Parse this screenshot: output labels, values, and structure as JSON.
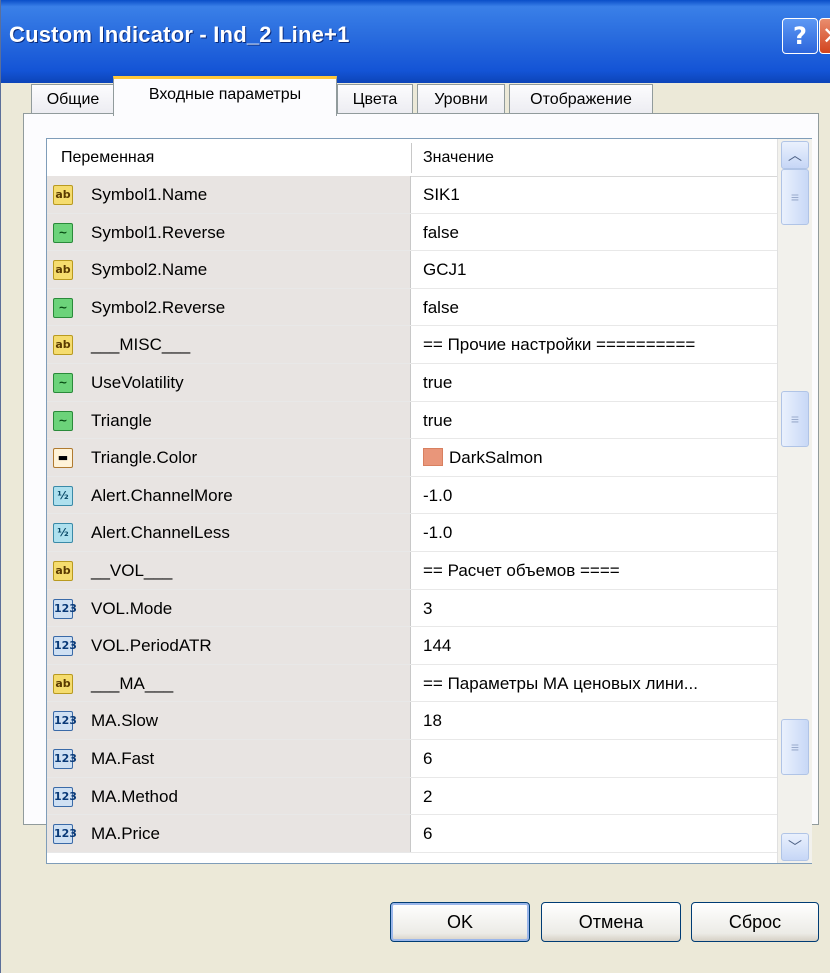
{
  "window": {
    "title": "Custom Indicator - Ind_2 Line+1",
    "help_glyph": "?",
    "close_glyph": "✕"
  },
  "tabs": [
    {
      "label": "Общие"
    },
    {
      "label": "Входные параметры",
      "active": true
    },
    {
      "label": "Цвета"
    },
    {
      "label": "Уровни"
    },
    {
      "label": "Отображение"
    }
  ],
  "grid": {
    "headers": {
      "variable": "Переменная",
      "value": "Значение"
    },
    "rows": [
      {
        "type": "string",
        "name": "Symbol1.Name",
        "value": "SIK1"
      },
      {
        "type": "bool",
        "name": "Symbol1.Reverse",
        "value": "false"
      },
      {
        "type": "string",
        "name": "Symbol2.Name",
        "value": "GCJ1"
      },
      {
        "type": "bool",
        "name": "Symbol2.Reverse",
        "value": "false"
      },
      {
        "type": "string",
        "name": "___MISC___",
        "value": "== Прочие настройки =========="
      },
      {
        "type": "bool",
        "name": "UseVolatility",
        "value": "true"
      },
      {
        "type": "bool",
        "name": "Triangle",
        "value": "true"
      },
      {
        "type": "color",
        "name": "Triangle.Color",
        "value": "DarkSalmon",
        "swatch": "#e9967a"
      },
      {
        "type": "double",
        "name": "Alert.ChannelMore",
        "value": "-1.0"
      },
      {
        "type": "double",
        "name": "Alert.ChannelLess",
        "value": "-1.0"
      },
      {
        "type": "string",
        "name": "__VOL___",
        "value": "== Расчет объемов ===="
      },
      {
        "type": "int",
        "name": "VOL.Mode",
        "value": "3"
      },
      {
        "type": "int",
        "name": "VOL.PeriodATR",
        "value": "144"
      },
      {
        "type": "string",
        "name": "___MA___",
        "value": "== Параметры МА ценовых лини..."
      },
      {
        "type": "int",
        "name": "MA.Slow",
        "value": "18"
      },
      {
        "type": "int",
        "name": "MA.Fast",
        "value": "6"
      },
      {
        "type": "int",
        "name": "MA.Method",
        "value": "2"
      },
      {
        "type": "int",
        "name": "MA.Price",
        "value": "6"
      }
    ]
  },
  "icon_glyphs": {
    "string": "ab",
    "bool": "∼",
    "color": "▬",
    "double": "½",
    "int": "123"
  },
  "buttons": {
    "ok": "OK",
    "cancel": "Отмена",
    "reset": "Сброс"
  }
}
